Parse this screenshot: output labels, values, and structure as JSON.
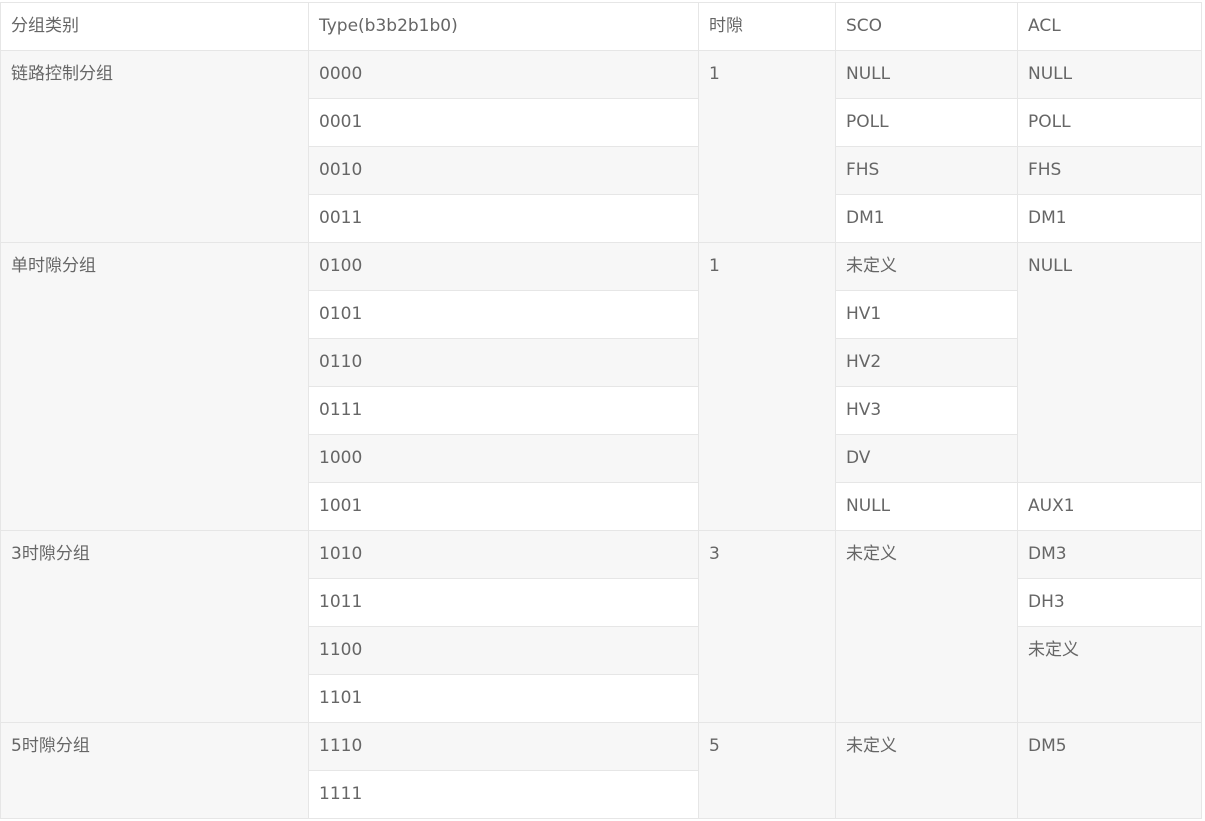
{
  "table": {
    "headers": [
      "分组类别",
      "Type(b3b2b1b0)",
      "时隙",
      "SCO",
      "ACL"
    ],
    "groups": [
      {
        "category": "链路控制分组",
        "slot": "1",
        "types": [
          "0000",
          "0001",
          "0010",
          "0011"
        ],
        "sco": [
          "NULL",
          "POLL",
          "FHS",
          "DM1"
        ],
        "acl": [
          "NULL",
          "POLL",
          "FHS",
          "DM1"
        ]
      },
      {
        "category": "单时隙分组",
        "slot": "1",
        "types": [
          "0100",
          "0101",
          "0110",
          "0111",
          "1000",
          "1001"
        ],
        "sco": [
          "未定义",
          "HV1",
          "HV2",
          "HV3",
          "DV",
          "NULL"
        ],
        "acl": [
          "NULL",
          "AUX1"
        ]
      },
      {
        "category": "3时隙分组",
        "slot": "3",
        "types": [
          "1010",
          "1011",
          "1100",
          "1101"
        ],
        "sco": [
          "未定义"
        ],
        "acl": [
          "DM3",
          "DH3",
          "未定义"
        ]
      },
      {
        "category": "5时隙分组",
        "slot": "5",
        "types": [
          "1110",
          "1111"
        ],
        "sco": [
          "未定义"
        ],
        "acl": [
          "DM5"
        ]
      }
    ]
  }
}
